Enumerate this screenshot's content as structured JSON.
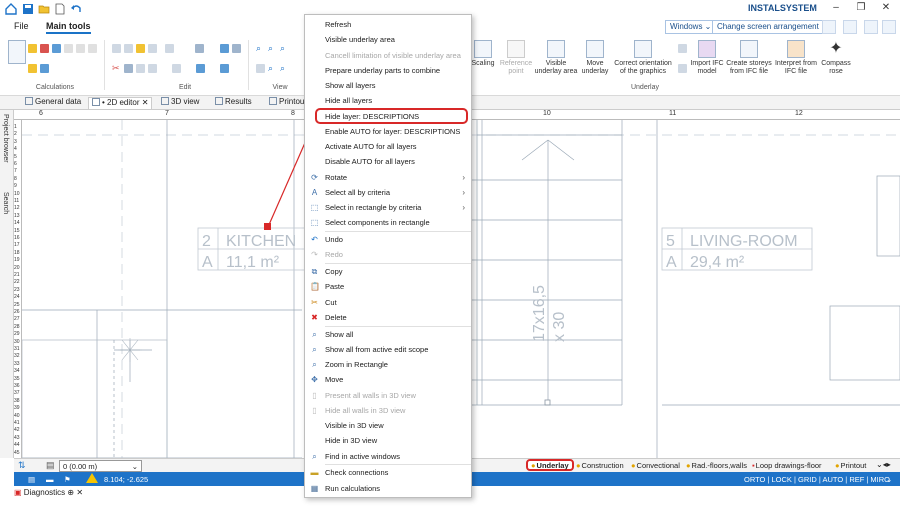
{
  "brand": "INSTALSYSTEM",
  "ribbon_tabs": {
    "file": "File",
    "main": "Main tools"
  },
  "header": {
    "windows_select": "Windows",
    "arrangement_select": "Change screen arrangement"
  },
  "ribbon": {
    "groups": {
      "calculations": "Calculations",
      "edit": "Edit",
      "view": "View",
      "underlay": "Underlay"
    },
    "buttons": {
      "scaling": "Scaling",
      "reference_point": "Reference point",
      "visible_underlay_area": "Visible underlay area",
      "move_underlay": "Move underlay",
      "correct_orientation": "Correct orientation of the graphics",
      "import_ifc": "Import IFC model",
      "create_storeys": "Create storeys from IFC file",
      "interpret_ifc": "Interpret from IFC file",
      "compass_rose": "Compass rose"
    }
  },
  "doc_tabs": [
    "General data",
    "• 2D editor",
    "3D view",
    "Results",
    "Printouts"
  ],
  "sidebar": {
    "project_browser": "Project browser",
    "search": "Search"
  },
  "ruler": {
    "top": [
      "6",
      "7",
      "8",
      "9",
      "10",
      "11",
      "12"
    ],
    "left": [
      "1",
      "2",
      "3",
      "4",
      "5",
      "6",
      "7",
      "8",
      "9",
      "10",
      "11",
      "12",
      "13",
      "14",
      "15",
      "16",
      "17",
      "18",
      "19",
      "20",
      "21",
      "22",
      "23",
      "24",
      "25",
      "26",
      "27",
      "28",
      "29",
      "30",
      "31",
      "32",
      "33",
      "34",
      "35",
      "36",
      "37",
      "38",
      "39",
      "40",
      "41",
      "42",
      "43",
      "44",
      "45"
    ]
  },
  "canvas": {
    "rooms": [
      {
        "number": "2",
        "name": "KITCHEN",
        "area": "11,1 m²"
      },
      {
        "number": "5",
        "name": "LIVING-ROOM",
        "area": "29,4 m²"
      }
    ],
    "stair_label_1": "17x16,5",
    "stair_label_2": "x 30"
  },
  "context_menu": {
    "items": [
      {
        "label": "Refresh",
        "icon": "",
        "disabled": false
      },
      {
        "label": "Visible underlay area",
        "icon": "",
        "disabled": false
      },
      {
        "label": "Cancell limitation of visible underlay area",
        "icon": "",
        "disabled": true
      },
      {
        "label": "Prepare underlay parts to combine",
        "icon": "",
        "disabled": false
      },
      {
        "label": "Show all layers",
        "icon": "",
        "disabled": false
      },
      {
        "label": "Hide all layers",
        "icon": "",
        "disabled": false
      },
      {
        "label": "Hide layer: DESCRIPTIONS",
        "icon": "",
        "disabled": false
      },
      {
        "label": "Enable AUTO for layer: DESCRIPTIONS",
        "icon": "",
        "disabled": false
      },
      {
        "label": "Activate AUTO for all layers",
        "icon": "",
        "disabled": false
      },
      {
        "label": "Disable AUTO for all layers",
        "icon": "",
        "disabled": false
      },
      {
        "label": "Rotate",
        "icon": "rotate-icon",
        "disabled": false,
        "submenu": true
      },
      {
        "label": "Select all by criteria",
        "icon": "select-criteria-icon",
        "disabled": false,
        "submenu": true
      },
      {
        "label": "Select in rectangle by criteria",
        "icon": "select-rect-criteria-icon",
        "disabled": false,
        "submenu": true
      },
      {
        "label": "Select components in rectangle",
        "icon": "select-components-icon",
        "disabled": false
      },
      {
        "label": "Undo",
        "icon": "undo-icon",
        "disabled": false
      },
      {
        "label": "Redo",
        "icon": "redo-icon",
        "disabled": true
      },
      {
        "label": "Copy",
        "icon": "copy-icon",
        "disabled": false
      },
      {
        "label": "Paste",
        "icon": "paste-icon",
        "disabled": false
      },
      {
        "label": "Cut",
        "icon": "cut-icon",
        "disabled": false
      },
      {
        "label": "Delete",
        "icon": "delete-icon",
        "disabled": false
      },
      {
        "label": "Show all",
        "icon": "zoom-all-icon",
        "disabled": false
      },
      {
        "label": "Show all from active edit scope",
        "icon": "zoom-scope-icon",
        "disabled": false
      },
      {
        "label": "Zoom in Rectangle",
        "icon": "zoom-rect-icon",
        "disabled": false
      },
      {
        "label": "Move",
        "icon": "move-icon",
        "disabled": false
      },
      {
        "label": "Present all walls in 3D view",
        "icon": "walls-3d-icon",
        "disabled": true
      },
      {
        "label": "Hide all walls in 3D view",
        "icon": "hide-walls-3d-icon",
        "disabled": true
      },
      {
        "label": "Visible in 3D view",
        "icon": "",
        "disabled": false
      },
      {
        "label": "Hide in 3D view",
        "icon": "",
        "disabled": false
      },
      {
        "label": "Find in active windows",
        "icon": "find-icon",
        "disabled": false
      },
      {
        "label": "Check connections",
        "icon": "check-connections-icon",
        "disabled": false
      },
      {
        "label": "Run calculations",
        "icon": "calculator-icon",
        "disabled": false
      }
    ]
  },
  "bottom": {
    "level": "0 (0.00 m)",
    "layers": [
      "Underlay",
      "Construction",
      "Convectional",
      "Rad.-floors,walls",
      "Loop drawings-floor",
      "Printout"
    ]
  },
  "status": {
    "coords": "8.104; -2.625",
    "flags": "ORTO | LOCK | GRID | AUTO | REF | MIRO"
  },
  "diagnostics": "Diagnostics",
  "colors": {
    "accent": "#1e73c8",
    "highlight": "#d82828",
    "plan_line": "#9aa8b6"
  }
}
